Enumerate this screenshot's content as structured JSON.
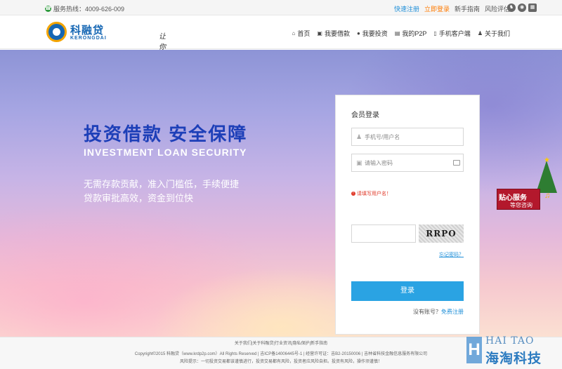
{
  "topbar": {
    "hotline": "服务热线：4009-626-009",
    "links": {
      "register": "快速注册",
      "login": "立即登录",
      "guide": "新手指南",
      "risk": "风险评估"
    }
  },
  "header": {
    "logo_cn": "科融贷",
    "logo_en": "KERONGDAI",
    "slogan": "让你爱上投资!",
    "nav": [
      {
        "icon": "home-icon",
        "glyph": "⌂",
        "label": "首页"
      },
      {
        "icon": "wallet-icon",
        "glyph": "▣",
        "label": "我要借款"
      },
      {
        "icon": "moneybag-icon",
        "glyph": "●",
        "label": "我要投资"
      },
      {
        "icon": "doc-icon",
        "glyph": "▤",
        "label": "我的P2P"
      },
      {
        "icon": "mobile-icon",
        "glyph": "▯",
        "label": "手机客户端"
      },
      {
        "icon": "user-icon",
        "glyph": "♟",
        "label": "关于我们"
      }
    ]
  },
  "hero": {
    "title": "投资借款 安全保障",
    "subtitle_en": "INVESTMENT LOAN SECURITY",
    "line1": "无需存款贡献，准入门槛低，手续便捷",
    "line2": "贷款审批高效，资金到位快"
  },
  "login": {
    "title": "会员登录",
    "username_placeholder": "手机号/用户名",
    "username_error": "请填写用户名！",
    "password_placeholder": "请输入密码",
    "captcha_text": "RRPO",
    "forgot": "忘记密码？",
    "submit": "登录",
    "no_account": "没有账号？",
    "register": "免费注册"
  },
  "xmas": {
    "line1": "贴心服务",
    "line2": "等您咨询"
  },
  "footer": {
    "links": "关于我们|关于科融贷|行业资讯|隐私保护|新手指南",
    "copyright": "Copyright©2015 科融贷（www.krdp2p.com）All Rights Reserved | 吉ICP备14006445号-1 | 经营许可证：吉B2-20150006 | 吉林省科技金融信息服务有限公司",
    "risk": "风险提示：一切投资交易都该谨慎进行，投资交易都有风险，投资者应风险自担。投资有风险，操作须谨慎！"
  },
  "watermark": {
    "en": "HAI TAO",
    "cn": "海淘科技",
    "letter": "H"
  },
  "colors": {
    "brand_blue": "#1667b4",
    "accent_blue": "#2aa3e3",
    "login_orange": "#ff7a00",
    "error_red": "#e03a2a"
  }
}
